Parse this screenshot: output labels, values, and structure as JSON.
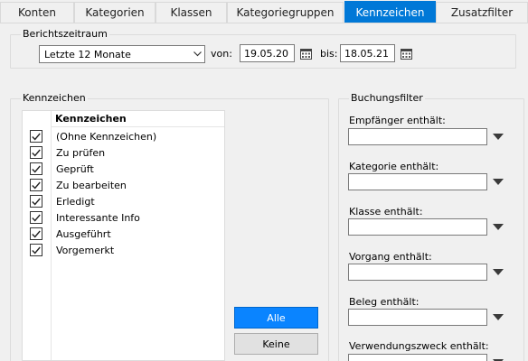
{
  "tabs": [
    {
      "label": "Konten",
      "active": false
    },
    {
      "label": "Kategorien",
      "active": false
    },
    {
      "label": "Klassen",
      "active": false
    },
    {
      "label": "Kategoriegruppen",
      "active": false
    },
    {
      "label": "Kennzeichen",
      "active": true
    },
    {
      "label": "Zusatzfilter",
      "active": false
    }
  ],
  "report_period": {
    "legend": "Berichtszeitraum",
    "range_value": "Letzte 12 Monate",
    "from_label": "von:",
    "from_value": "19.05.20",
    "to_label": "bis:",
    "to_value": "18.05.21"
  },
  "flags": {
    "legend": "Kennzeichen",
    "column_header": "Kennzeichen",
    "items": [
      {
        "label": "(Ohne Kennzeichen)",
        "checked": true
      },
      {
        "label": "Zu prüfen",
        "checked": true
      },
      {
        "label": "Geprüft",
        "checked": true
      },
      {
        "label": "Zu bearbeiten",
        "checked": true
      },
      {
        "label": "Erledigt",
        "checked": true
      },
      {
        "label": "Interessante Info",
        "checked": true
      },
      {
        "label": "Ausgeführt",
        "checked": true
      },
      {
        "label": "Vorgemerkt",
        "checked": true
      }
    ],
    "all_button": "Alle",
    "none_button": "Keine"
  },
  "booking_filter": {
    "legend": "Buchungsfilter",
    "fields": [
      {
        "label": "Empfänger enthält:",
        "value": ""
      },
      {
        "label": "Kategorie enthält:",
        "value": ""
      },
      {
        "label": "Klasse enthält:",
        "value": ""
      },
      {
        "label": "Vorgang enthält:",
        "value": ""
      },
      {
        "label": "Beleg enthält:",
        "value": ""
      },
      {
        "label": "Verwendungszweck enthält:",
        "value": ""
      }
    ]
  },
  "colors": {
    "accent": "#0078d7",
    "primary_button": "#0a84ff",
    "window_bg": "#f0f0f0"
  }
}
